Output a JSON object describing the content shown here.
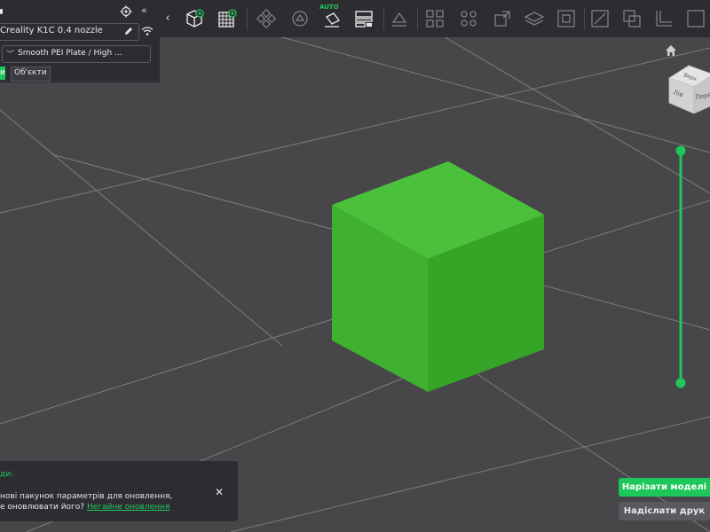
{
  "left_panel": {
    "printer_name": "Creality K1C 0.4 nozzle",
    "plate_preset": "Smooth PEI Plate / High ...",
    "tabs": {
      "active_fragment": "ий",
      "objects": "Об'єкти"
    }
  },
  "toolbar": {
    "auto_label": "AUTO"
  },
  "view_cube": {
    "top_face": "Верх",
    "left_face": "Лів",
    "front_face": "Перед"
  },
  "notification": {
    "title": "ди:",
    "line1": "нові пакунок параметрів для оновлення,",
    "line2": "е оновлювати його?",
    "link": "Негайне оновлення"
  },
  "actions": {
    "slice_label": "Нарізати моделі",
    "send_label": "Надіслати друк"
  },
  "colors": {
    "accent": "#1ec75a",
    "cube_top": "#4bc03b",
    "cube_left": "#3fb02f",
    "cube_right": "#36a427",
    "background": "#47474a",
    "panel": "#2d2d31"
  }
}
